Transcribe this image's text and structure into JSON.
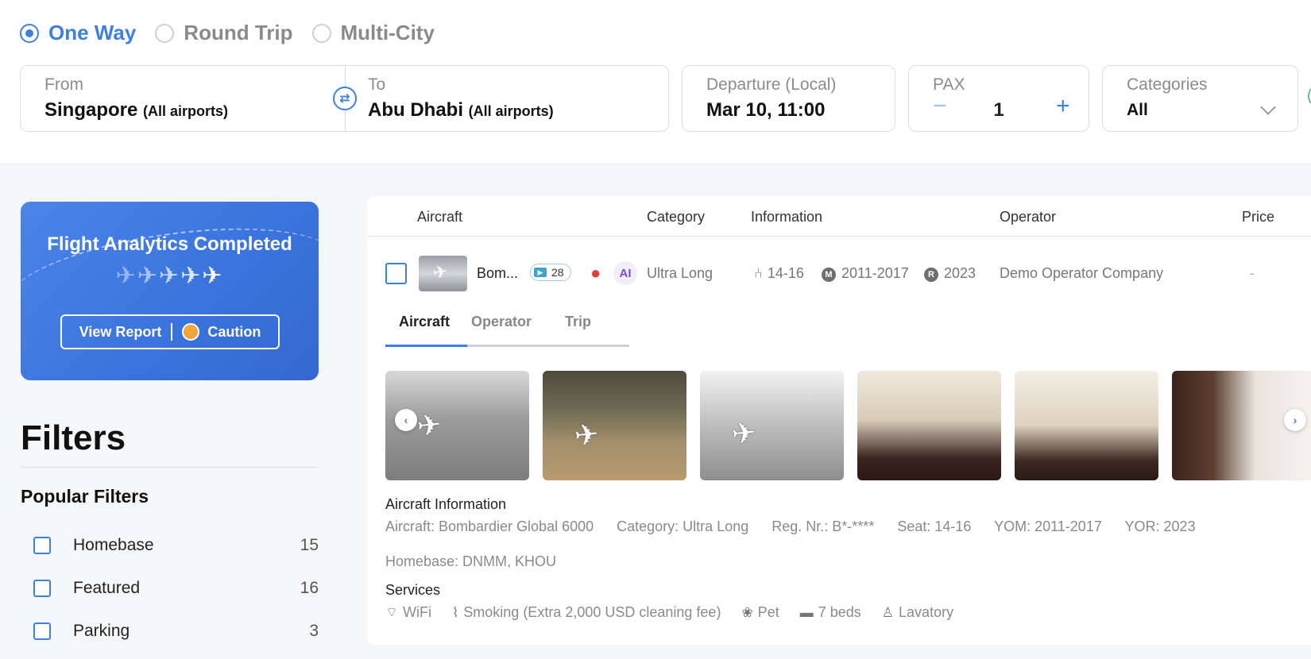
{
  "trip_types": [
    {
      "label": "One Way",
      "active": true
    },
    {
      "label": "Round Trip",
      "active": false
    },
    {
      "label": "Multi-City",
      "active": false
    }
  ],
  "search": {
    "from_label": "From",
    "from_value": "Singapore",
    "from_sub": "(All airports)",
    "to_label": "To",
    "to_value": "Abu Dhabi",
    "to_sub": "(All airports)",
    "date_label": "Departure (Local)",
    "date_value": "Mar 10, 11:00",
    "pax_label": "PAX",
    "pax_value": "1",
    "pax_minus": "−",
    "pax_plus": "+",
    "categories_label": "Categories",
    "categories_value": "All"
  },
  "analytics": {
    "title": "Flight Analytics Completed",
    "report_label": "View Report",
    "status_label": "Caution",
    "status_color": "#f0a63a"
  },
  "filters": {
    "title": "Filters",
    "popular_title": "Popular Filters",
    "items": [
      {
        "label": "Homebase",
        "count": "15"
      },
      {
        "label": "Featured",
        "count": "16"
      },
      {
        "label": "Parking",
        "count": "3"
      }
    ]
  },
  "table": {
    "headers": [
      "Aircraft",
      "Category",
      "Information",
      "Operator",
      "Price"
    ],
    "row": {
      "name": "Bom...",
      "badge_count": "28",
      "ai_label": "AI",
      "category": "Ultra Long",
      "seats": "14-16",
      "yom": "2011-2017",
      "yor": "2023",
      "operator": "Demo Operator Company",
      "price": "-"
    }
  },
  "detail_tabs": [
    "Aircraft",
    "Operator",
    "Trip"
  ],
  "aircraft_info": {
    "title": "Aircraft Information",
    "aircraft": "Aircraft: Bombardier Global 6000",
    "category": "Category: Ultra Long",
    "reg": "Reg. Nr.: B*-****",
    "seat": "Seat: 14-16",
    "yom": "YOM: 2011-2017",
    "yor": "YOR: 2023",
    "homebase": "Homebase: DNMM, KHOU"
  },
  "services": {
    "title": "Services",
    "items": [
      {
        "label": "WiFi",
        "icon": "wifi-icon"
      },
      {
        "label": "Smoking (Extra 2,000 USD cleaning fee)",
        "icon": "smoking-icon"
      },
      {
        "label": "Pet",
        "icon": "paw-icon"
      },
      {
        "label": "7 beds",
        "icon": "bed-icon"
      },
      {
        "label": "Lavatory",
        "icon": "toilet-icon"
      }
    ]
  },
  "colors": {
    "accent": "#3f7fe0",
    "card_blue": "#3a73dd"
  }
}
